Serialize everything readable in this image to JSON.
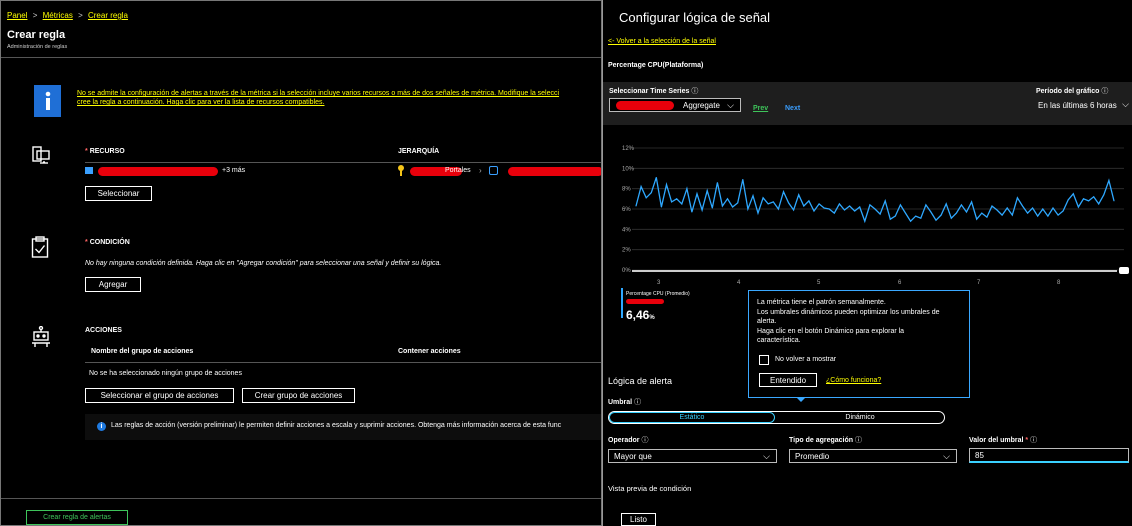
{
  "breadcrumb": {
    "panel": "Panel",
    "metrics": "Métricas",
    "current": "Crear regla",
    "sep": ">"
  },
  "page": {
    "title": "Crear regla",
    "subtitle": "Administración de reglas"
  },
  "info_banner": {
    "line1": "No se admite la configuración de alertas a través de la métrica si la selección incluye varios recursos o más de dos señales de métrica. Modifique la selecci",
    "line2": "cree la regla a continuación. Haga clic para ver la lista de recursos compatibles."
  },
  "resource": {
    "label": "RECURSO",
    "hierarchy_label": "JERARQUÍA",
    "more": "+3 más",
    "portals": "Portales",
    "select_button": "Seleccionar"
  },
  "condition": {
    "label": "CONDICIÓN",
    "empty_text": "No hay ninguna condición definida. Haga clic en \"Agregar condición\" para seleccionar una señal y definir su lógica.",
    "add_button": "Agregar"
  },
  "actions": {
    "label": "ACCIONES",
    "col_name": "Nombre del grupo de acciones",
    "col_contains": "Contener acciones",
    "empty_text": "No se ha seleccionado ningún grupo de acciones",
    "select_button": "Seleccionar el grupo de acciones",
    "create_button": "Crear grupo de acciones",
    "info_text": "Las reglas de acción (versión preliminar) le permiten definir acciones a escala y suprimir acciones. Obtenga más información acerca de esta func"
  },
  "footer": {
    "create_button": "Crear regla de alertas"
  },
  "signal_panel": {
    "title": "Configurar lógica de señal",
    "back_link": "<- Volver a la selección de la señal",
    "signal_name": "Percentage CPU(Plataforma)",
    "timeseries_label": "Seleccionar Time Series",
    "aggregate": "Aggregate",
    "prev": "Prev",
    "next": "Next",
    "period_label": "Período del gráfico",
    "period_value": "En las últimas 6 horas",
    "legend_label": "Percentage CPU (Promedio)",
    "legend_value": "6,46",
    "legend_unit": "%",
    "tooltip": {
      "line1": "La métrica tiene el patrón semanalmente.",
      "line2": "Los umbrales dinámicos pueden optimizar los umbrales de",
      "line3": "alerta.",
      "line4": "Haga clic en el botón Dinámico para explorar la",
      "line5": "característica.",
      "checkbox": "No volver a mostrar",
      "ok_button": "Entendido",
      "how_link": "¿Cómo funciona?"
    },
    "alert_logic": "Lógica de alerta",
    "threshold_label": "Umbral",
    "static": "Estático",
    "dynamic": "Dinámico",
    "operator_label": "Operador",
    "operator_value": "Mayor que",
    "aggregation_label": "Tipo de agregación",
    "aggregation_value": "Promedio",
    "threshold_value_label": "Valor del umbral",
    "threshold_value": "85",
    "preview_label": "Vista previa de condición",
    "done_button": "Listo"
  },
  "chart_data": {
    "type": "line",
    "y_ticks": [
      "12%",
      "10%",
      "8%",
      "6%",
      "4%",
      "2%",
      "0%"
    ],
    "x_ticks": [
      "3",
      "4",
      "5",
      "6",
      "7",
      "8"
    ],
    "ylim": [
      0,
      12
    ],
    "color": "#2ea8ff",
    "series": [
      {
        "values": [
          6.3,
          8.2,
          7.1,
          7.6,
          9.1,
          6.2,
          8.4,
          6.7,
          7.0,
          6.5,
          8.0,
          5.7,
          7.5,
          5.9,
          7.8,
          6.1,
          8.6,
          6.3,
          7.0,
          6.2,
          6.6,
          8.9,
          6.0,
          7.3,
          5.6,
          7.1,
          6.5,
          6.7,
          6.0,
          7.7,
          6.6,
          5.9,
          7.4,
          6.3,
          6.8,
          5.8,
          6.5,
          6.1,
          6.0,
          5.6,
          6.5,
          5.9,
          6.3,
          5.8,
          6.2,
          4.8,
          6.4,
          6.0,
          5.5,
          6.8,
          5.0,
          5.3,
          6.4,
          5.6,
          4.8,
          5.3,
          5.1,
          6.4,
          5.7,
          4.9,
          5.4,
          6.5,
          5.1,
          5.6,
          6.4,
          5.7,
          6.7,
          5.0,
          5.6,
          5.2,
          6.3,
          5.9,
          5.4,
          6.1,
          5.4,
          7.1,
          6.3,
          5.6,
          6.1,
          5.3,
          6.0,
          5.3,
          6.1,
          5.4,
          5.8,
          6.9,
          7.5,
          6.2,
          7.0,
          6.8,
          7.2,
          6.5,
          7.4,
          8.8,
          6.8
        ]
      }
    ]
  }
}
